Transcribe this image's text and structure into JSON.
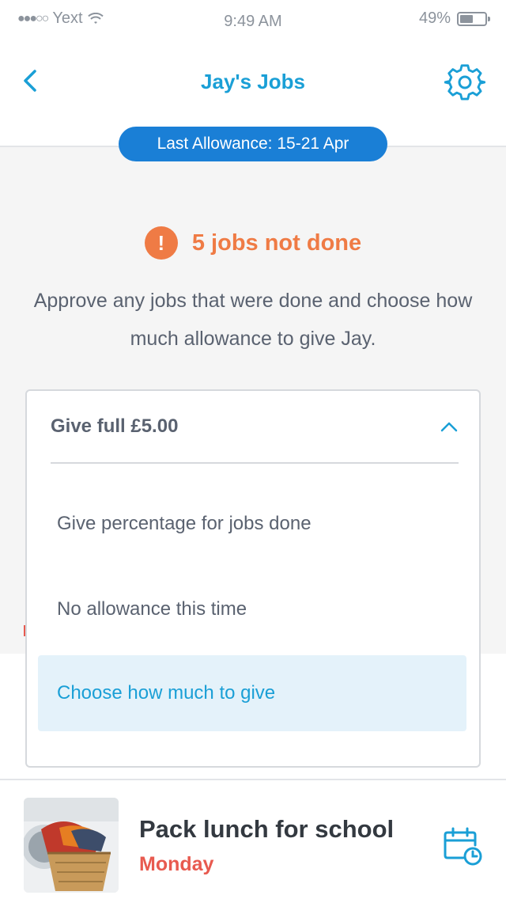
{
  "status_bar": {
    "signal": "●●●○○",
    "carrier": "Yext",
    "time": "9:49 AM",
    "battery": "49%"
  },
  "nav": {
    "title": "Jay's Jobs",
    "back_icon": "chevron-left-icon",
    "settings_icon": "gear-icon"
  },
  "allowance_pill": "Last Allowance: 15-21 Apr",
  "alert": {
    "icon_text": "!",
    "text": "5 jobs not done"
  },
  "info_text": "Approve any jobs that were done and choose how much allowance to give Jay.",
  "dropdown": {
    "selected": "Give full £5.00",
    "options": [
      "Give percentage for jobs done",
      "No allowance this time",
      "Choose how much to give"
    ]
  },
  "task": {
    "title": "Pack lunch for school",
    "day": "Monday",
    "icon": "calendar-clock-icon"
  },
  "colors": {
    "accent": "#1a9fd6",
    "pill": "#1a7fd6",
    "alert": "#ef7b45",
    "day": "#e85a4f"
  }
}
